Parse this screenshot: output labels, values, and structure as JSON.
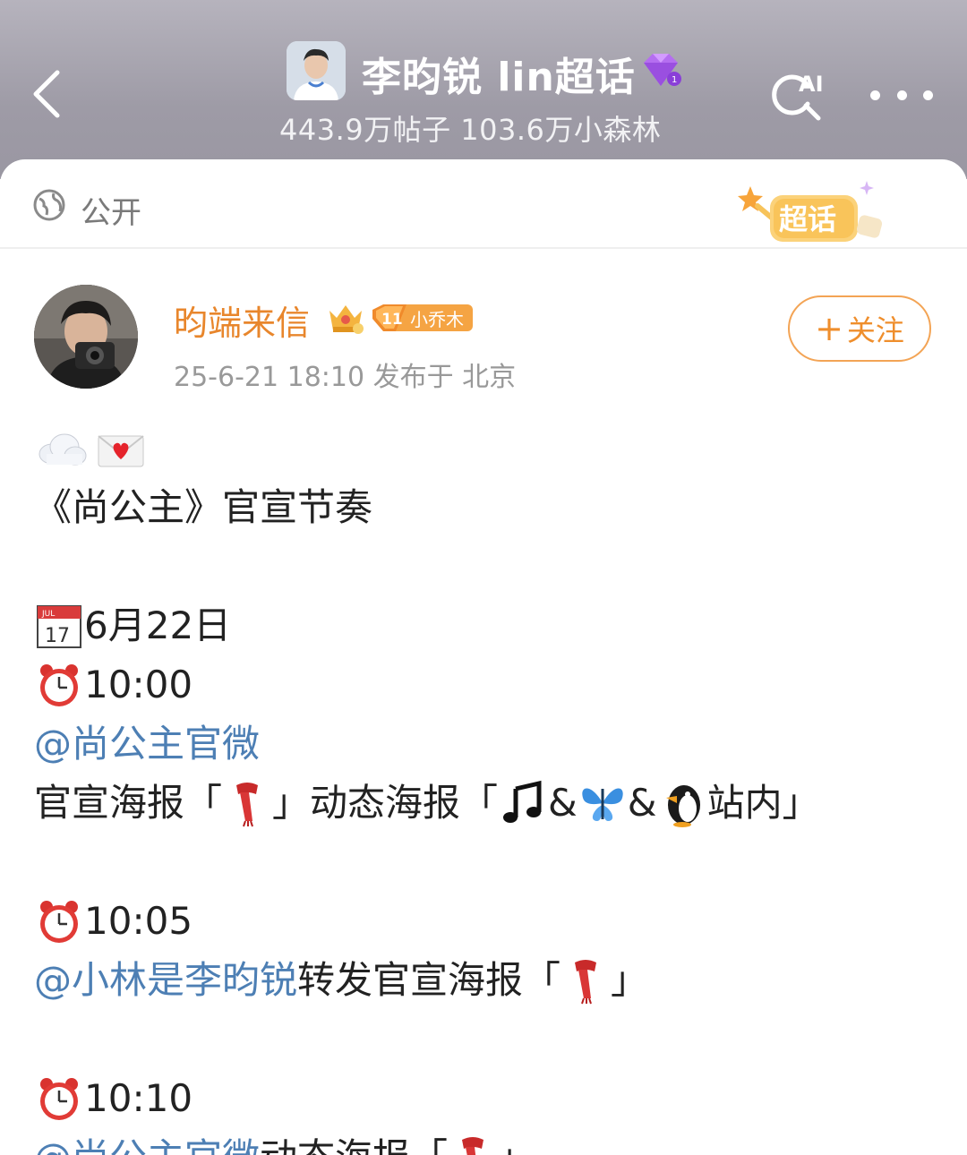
{
  "header": {
    "back_icon": "chevron-left-icon",
    "topic_title": "李昀锐 lin超话",
    "topic_stats": "443.9万帖子 103.6万小森林",
    "ai_search_label": "AI",
    "more_icon": "more-horizontal-icon"
  },
  "post": {
    "visibility": "公开",
    "badge_label": "超话",
    "author": {
      "name": "昀端来信",
      "fan_level": "11",
      "fan_label": "小乔木"
    },
    "meta": "25-6-21 18:10  发布于 北京",
    "follow_label": "关注",
    "lines": {
      "title": "《尚公主》官宣节奏",
      "date": "6月22日",
      "time1": "10:00",
      "mention1": "@尚公主官微",
      "poster_a": "官宣海报「",
      "poster_b": "」动态海报「",
      "amp1": " & ",
      "amp2": " & ",
      "poster_c": "站内」",
      "time2": "10:05",
      "mention2": "@小林是李昀锐",
      "repost": " 转发官宣海报「",
      "close1": "」",
      "time3": "10:10",
      "mention3": "@尚公主官微",
      "dynamic": " 动态海报「",
      "close2": "」"
    }
  },
  "colors": {
    "accent_orange": "#e8862c",
    "mention_blue": "#4d7fb4",
    "header_bg": "#a7a4ae"
  }
}
